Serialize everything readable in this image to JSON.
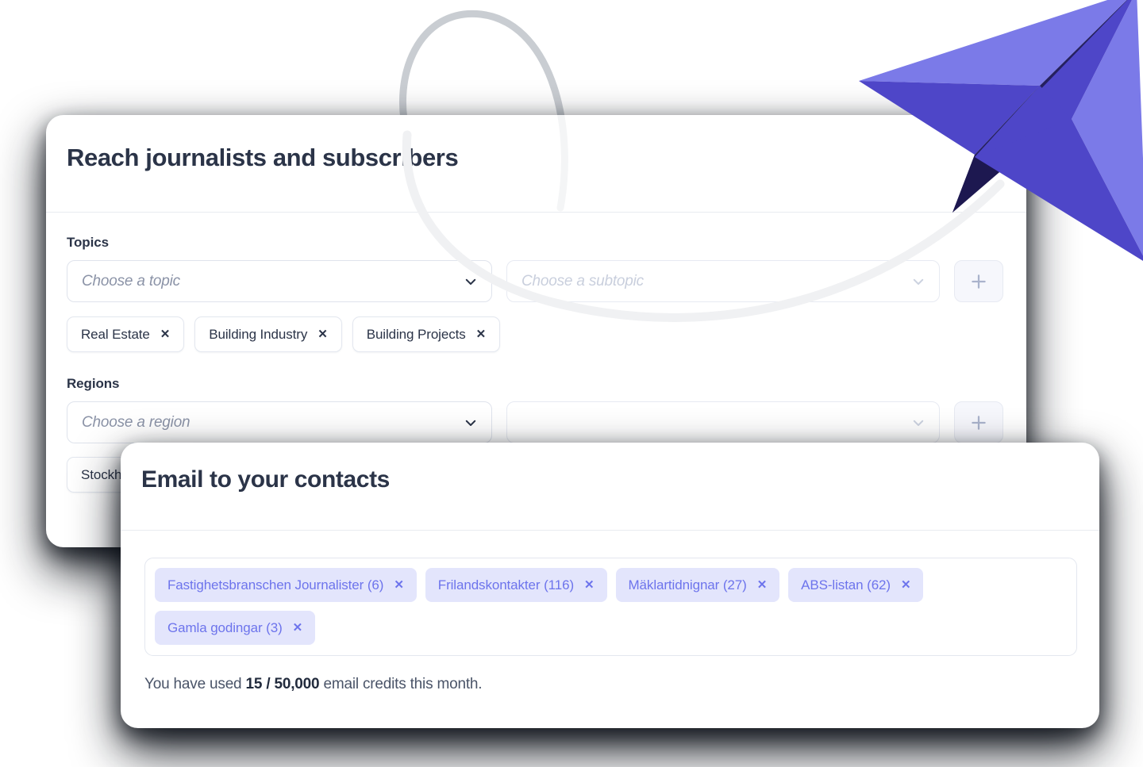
{
  "illustration": {
    "plane": {
      "name": "paper-plane",
      "color_light": "#7b7ae8",
      "color_mid": "#4e46c8",
      "color_dark": "#252060"
    },
    "swoosh": {
      "name": "looping-swoosh-line",
      "color_outside": "#c9cdd2",
      "color_inside": "#f0f1f3"
    }
  },
  "cards": {
    "topics": {
      "title": "Reach journalists and subscribers",
      "topics": {
        "label": "Topics",
        "topic_select": {
          "placeholder": "Choose a topic",
          "value": "",
          "chevron": "chevron-down-icon"
        },
        "subtopic_select": {
          "placeholder": "Choose a subtopic",
          "value": "",
          "disabled": true,
          "chevron": "chevron-down-icon"
        },
        "add_button": "plus-icon",
        "tags": [
          {
            "label": "Real Estate",
            "remove": "✕"
          },
          {
            "label": "Building Industry",
            "remove": "✕"
          },
          {
            "label": "Building Projects",
            "remove": "✕"
          }
        ]
      },
      "regions": {
        "label": "Regions",
        "region_select": {
          "placeholder": "Choose a region",
          "value": "",
          "chevron": "chevron-down-icon"
        },
        "subregion_select": {
          "placeholder": "",
          "value": "",
          "disabled": true,
          "chevron": "chevron-down-icon"
        },
        "add_button": "plus-icon",
        "tags": [
          {
            "label": "Stockholm",
            "remove": "✕"
          }
        ]
      }
    },
    "contacts": {
      "title": "Email to your contacts",
      "chips": [
        {
          "label": "Fastighetsbranschen Journalister (6)",
          "remove": "✕"
        },
        {
          "label": "Frilandskontakter (116)",
          "remove": "✕"
        },
        {
          "label": "Mäklartidnignar (27)",
          "remove": "✕"
        },
        {
          "label": "ABS-listan (62)",
          "remove": "✕"
        },
        {
          "label": "Gamla godingar (3)",
          "remove": "✕"
        }
      ],
      "credits": {
        "prefix": "You have used ",
        "amount": "15 / 50,000",
        "suffix": " email credits this month."
      }
    }
  },
  "colors": {
    "accent": "#6d74ec",
    "chip_bg": "#e3e5fc",
    "text_dark": "#2b3448",
    "border": "#dfe3ec"
  }
}
